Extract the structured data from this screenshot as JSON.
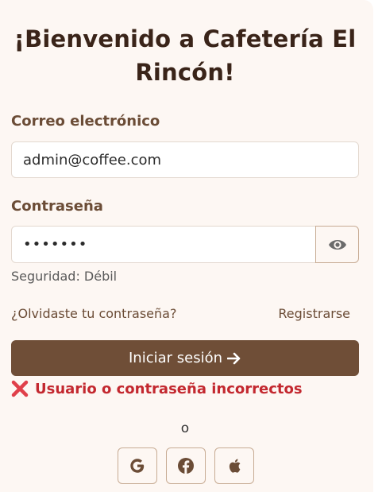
{
  "header": {
    "title": "¡Bienvenido a Cafetería El Rincón!"
  },
  "form": {
    "email_label": "Correo electrónico",
    "email_value": "admin@coffee.com",
    "password_label": "Contraseña",
    "password_value": "•••••••",
    "strength_text": "Seguridad: Débil",
    "forgot_link": "¿Olvidaste tu contraseña?",
    "register_link": "Registrarse",
    "submit_label": "Iniciar sesión",
    "submit_icon": "arrow-right-icon",
    "error_icon": "x-mark-icon",
    "error_text": "Usuario o contraseña incorrectos"
  },
  "alt_login": {
    "separator": "o",
    "providers": [
      "google",
      "facebook",
      "apple"
    ]
  },
  "colors": {
    "background": "#fdf7f3",
    "primary": "#6f4e37",
    "label": "#6b4c36",
    "error": "#c3282f",
    "outline": "#c7ab93"
  }
}
